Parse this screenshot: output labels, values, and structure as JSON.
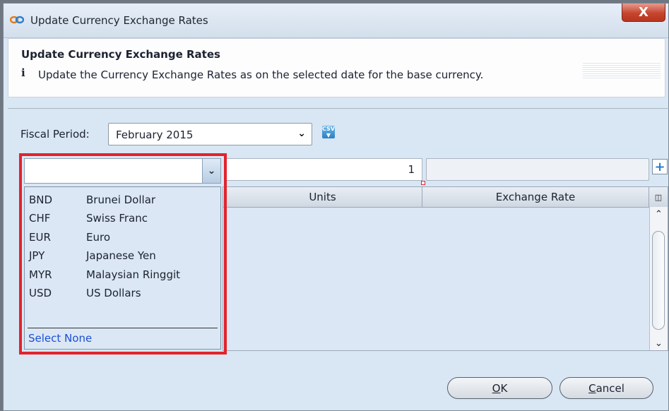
{
  "window": {
    "title": "Update Currency Exchange Rates",
    "close_label": "X"
  },
  "header": {
    "title": "Update Currency Exchange Rates",
    "info_icon": "i",
    "description": "Update the Currency Exchange Rates as on the selected date for the base currency."
  },
  "fiscal_period": {
    "label": "Fiscal Period:",
    "value": "February 2015",
    "csv_label": "CSV"
  },
  "entry": {
    "currency_value": "",
    "units_value": "1",
    "rate_value": "",
    "add_label": "+"
  },
  "grid": {
    "columns": [
      "Units",
      "Exchange Rate"
    ]
  },
  "dropdown": {
    "options": [
      {
        "code": "BND",
        "name": "Brunei Dollar"
      },
      {
        "code": "CHF",
        "name": "Swiss Franc"
      },
      {
        "code": "EUR",
        "name": "Euro"
      },
      {
        "code": "JPY",
        "name": "Japanese Yen"
      },
      {
        "code": "MYR",
        "name": "Malaysian Ringgit"
      },
      {
        "code": "USD",
        "name": "US Dollars"
      }
    ],
    "select_none": "Select None"
  },
  "buttons": {
    "ok_first": "O",
    "ok_rest": "K",
    "cancel_first": "C",
    "cancel_rest": "ancel"
  },
  "colors": {
    "highlight": "#e3222c",
    "link": "#1c4fd6"
  }
}
